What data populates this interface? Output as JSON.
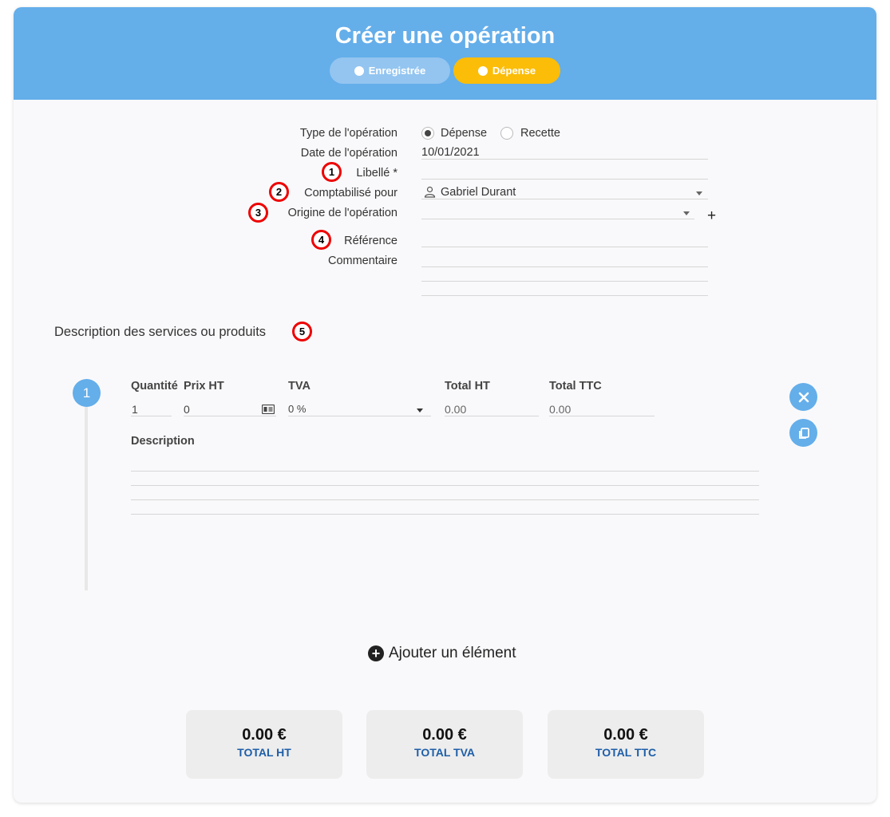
{
  "header": {
    "title": "Créer une opération",
    "pills": {
      "enregistree": "Enregistrée",
      "depense": "Dépense"
    }
  },
  "form": {
    "type_label": "Type de l'opération",
    "type_options": {
      "depense": "Dépense",
      "recette": "Recette"
    },
    "type_selected": "Dépense",
    "date_label": "Date de l'opération",
    "date_value": "10/01/2021",
    "libelle_label": "Libellé *",
    "comptabilise_label": "Comptabilisé pour",
    "comptabilise_value": "Gabriel Durant",
    "origine_label": "Origine de l'opération",
    "reference_label": "Référence",
    "commentaire_label": "Commentaire",
    "add_origin": "+"
  },
  "badges": {
    "b1": "1",
    "b2": "2",
    "b3": "3",
    "b4": "4",
    "b5": "5"
  },
  "items_section": {
    "title": "Description des services ou produits",
    "item": {
      "number": "1",
      "headers": {
        "quantite": "Quantité",
        "prix_ht": "Prix HT",
        "tva": "TVA",
        "total_ht": "Total HT",
        "total_ttc": "Total TTC"
      },
      "values": {
        "quantite": "1",
        "prix_ht": "0",
        "tva": "0 %",
        "total_ht": "0.00",
        "total_ttc": "0.00"
      },
      "description_label": "Description"
    },
    "add_label": "Ajouter un élément"
  },
  "totals": [
    {
      "amount": "0.00 €",
      "label": "TOTAL HT"
    },
    {
      "amount": "0.00 €",
      "label": "TOTAL TVA"
    },
    {
      "amount": "0.00 €",
      "label": "TOTAL TTC"
    }
  ],
  "icons": {
    "user": "user-icon",
    "calculator": "calculator-icon",
    "close": "close-icon",
    "copy": "copy-icon",
    "add": "plus-circle-icon"
  },
  "colors": {
    "header": "#64aeea",
    "active_pill": "#fbbd08",
    "badge_ring": "#e00000",
    "total_label": "#1e5ea8"
  }
}
